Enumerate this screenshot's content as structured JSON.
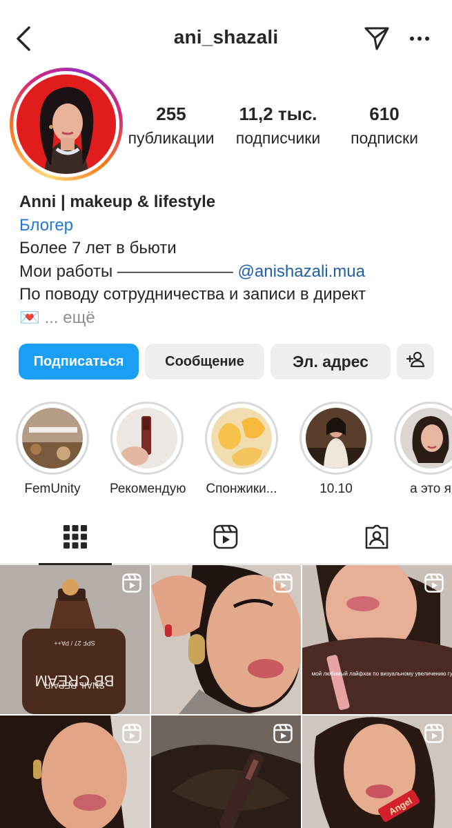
{
  "header": {
    "username": "ani_shazali"
  },
  "stats": [
    {
      "value": "255",
      "label": "публикации"
    },
    {
      "value": "11,2 тыс.",
      "label": "подписчики"
    },
    {
      "value": "610",
      "label": "подписки"
    }
  ],
  "bio": {
    "name": "Anni | makeup & lifestyle",
    "category": "Блогер",
    "line1": "Более 7 лет в бьюти",
    "line2_prefix": "Мои работы ——————— ",
    "line2_mention": "@anishazali.mua",
    "line3": "По поводу сотрудничества и записи в директ",
    "line4_emoji": "💌",
    "line4_more": "... ещё"
  },
  "buttons": {
    "follow": "Подписаться",
    "message": "Сообщение",
    "email": "Эл. адрес"
  },
  "highlights": [
    {
      "label": "FemUnity"
    },
    {
      "label": "Рекомендую"
    },
    {
      "label": "Спонжики..."
    },
    {
      "label": "10.10"
    },
    {
      "label": "а это я"
    }
  ],
  "grid": {
    "caption_3": "мой любимый лайфхак по визуальному увеличению губ",
    "product_text_1": "SNAIL REPAIR",
    "product_text_2": "BB CREAM",
    "product_text_3": "SPF 27 / PA++",
    "product_text_6": "Angel"
  },
  "colors": {
    "follow_button": "#1a9ff2",
    "category_link": "#1e78d6",
    "secondary_button": "#efefef"
  }
}
